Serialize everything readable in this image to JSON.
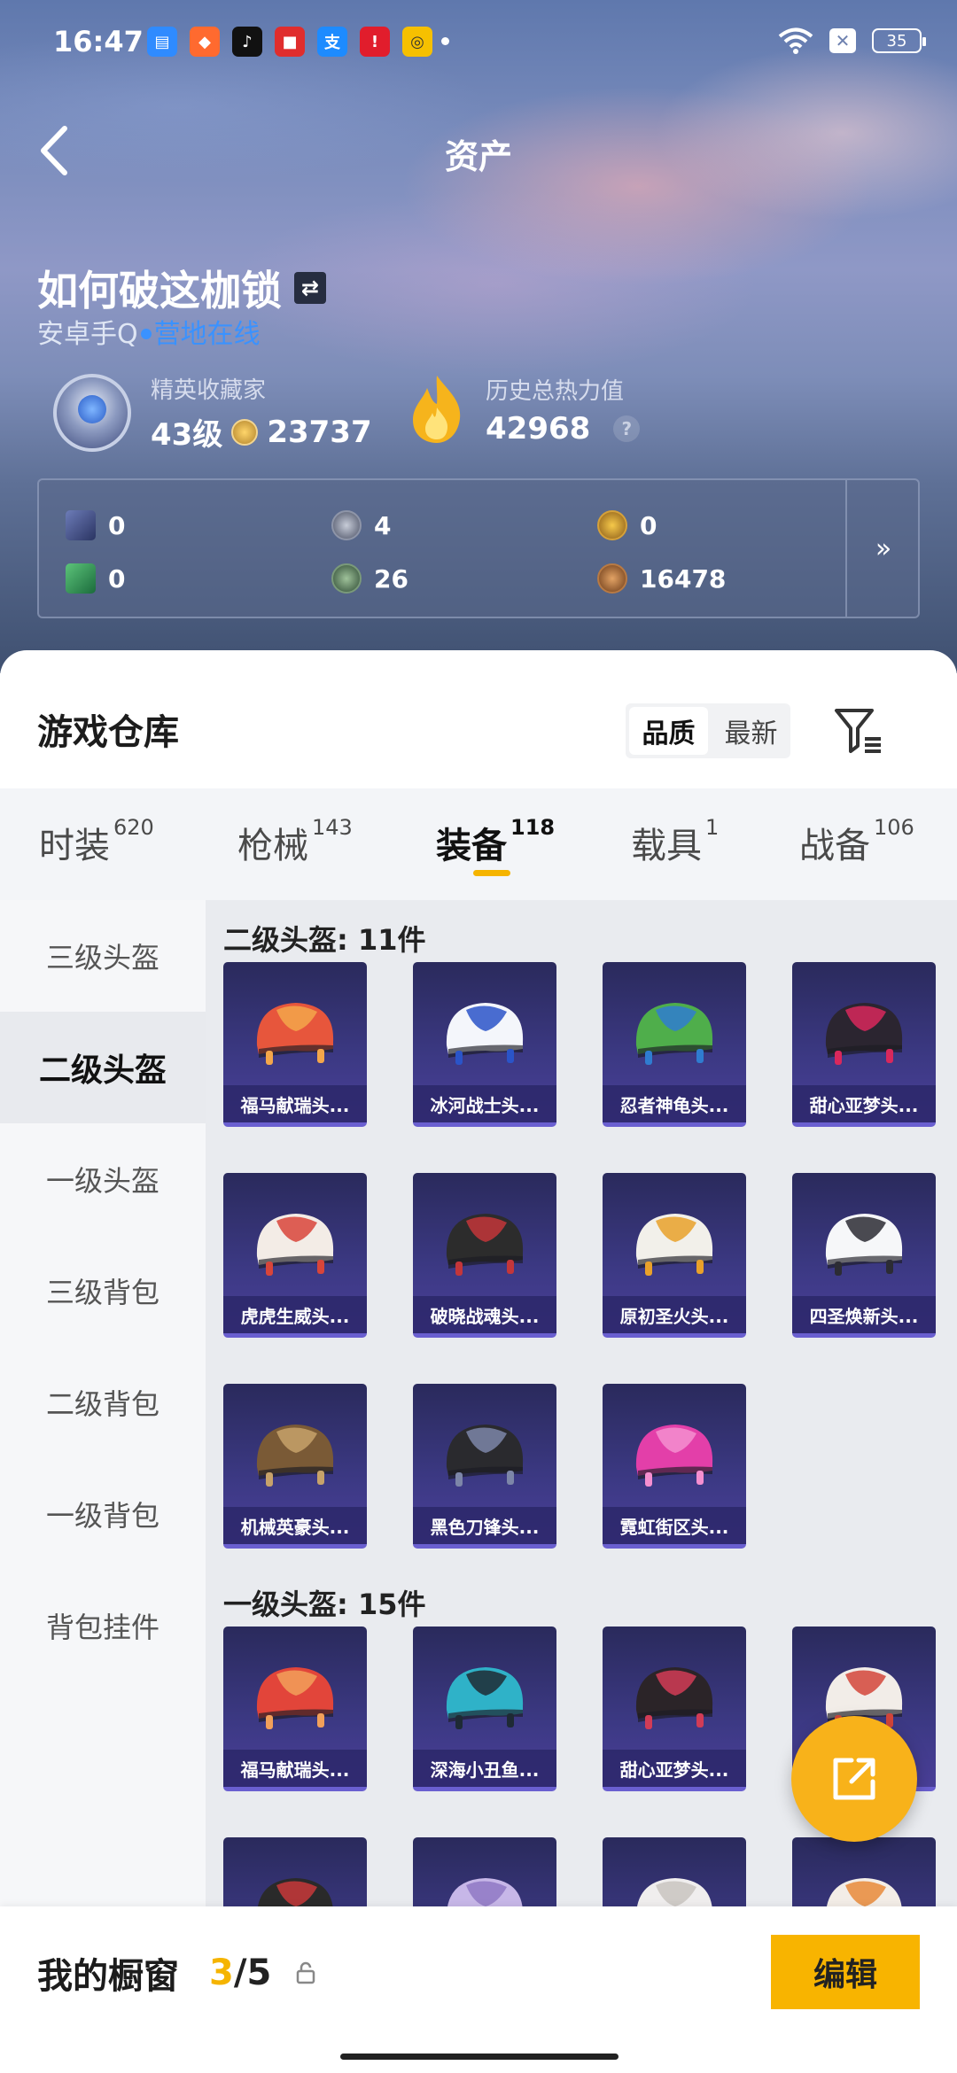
{
  "status_bar": {
    "time": "16:47",
    "battery": "35"
  },
  "header": {
    "title": "资产"
  },
  "profile": {
    "name": "如何破这枷锁",
    "platform": "安卓手Q",
    "online": "营地在线",
    "collector_label": "精英收藏家",
    "level": "43级",
    "collector_points": "23737",
    "heat_label": "历史总热力值",
    "heat_value": "42968",
    "help": "?"
  },
  "currencies": {
    "row1": [
      "0",
      "4",
      "0"
    ],
    "row2": [
      "0",
      "26",
      "16478"
    ],
    "more": "»"
  },
  "warehouse": {
    "title": "游戏仓库",
    "sort_options": [
      "品质",
      "最新"
    ],
    "active_sort": "品质",
    "tabs": [
      {
        "label": "时装",
        "count": "620"
      },
      {
        "label": "枪械",
        "count": "143"
      },
      {
        "label": "装备",
        "count": "118"
      },
      {
        "label": "载具",
        "count": "1"
      },
      {
        "label": "战备",
        "count": "106"
      }
    ],
    "active_tab": "装备",
    "sidebar": [
      "三级头盔",
      "二级头盔",
      "一级头盔",
      "三级背包",
      "二级背包",
      "一级背包",
      "背包挂件"
    ],
    "active_sidebar": "二级头盔",
    "sections": [
      {
        "title": "二级头盔: 11件",
        "items": [
          {
            "name": "福马献瑞头...",
            "colors": [
              "#e7563c",
              "#f3a64a"
            ]
          },
          {
            "name": "冰河战士头...",
            "colors": [
              "#f4f6fb",
              "#2a54c8"
            ]
          },
          {
            "name": "忍者神龟头...",
            "colors": [
              "#4fae4b",
              "#2f7cd0"
            ]
          },
          {
            "name": "甜心亚梦头...",
            "colors": [
              "#2b2530",
              "#d8285c"
            ]
          },
          {
            "name": "虎虎生威头...",
            "colors": [
              "#f3ece6",
              "#d8453a"
            ]
          },
          {
            "name": "破晓战魂头...",
            "colors": [
              "#2c2c2c",
              "#c3363a"
            ]
          },
          {
            "name": "原初圣火头...",
            "colors": [
              "#f2f0ea",
              "#e9a12a"
            ]
          },
          {
            "name": "四圣焕新头...",
            "colors": [
              "#f6f7f9",
              "#2c2c34"
            ]
          },
          {
            "name": "机械英豪头...",
            "colors": [
              "#7a5a36",
              "#c7a26a"
            ]
          },
          {
            "name": "黑色刀锋头...",
            "colors": [
              "#2a2a2e",
              "#7d86a8"
            ]
          },
          {
            "name": "霓虹街区头...",
            "colors": [
              "#e33fa9",
              "#f58fd0"
            ]
          }
        ]
      },
      {
        "title": "一级头盔: 15件",
        "items": [
          {
            "name": "福马献瑞头...",
            "colors": [
              "#e2453a",
              "#f2a05a"
            ]
          },
          {
            "name": "深海小丑鱼...",
            "colors": [
              "#2fb2c8",
              "#1e2a34"
            ]
          },
          {
            "name": "甜心亚梦头...",
            "colors": [
              "#2b2428",
              "#d23c56"
            ]
          },
          {
            "name": "",
            "colors": [
              "#f2ede8",
              "#d3453a"
            ]
          },
          {
            "name": "",
            "colors": [
              "#2a2a2a",
              "#c8383a"
            ]
          },
          {
            "name": "",
            "colors": [
              "#c7b7e8",
              "#8f79c4"
            ]
          },
          {
            "name": "",
            "colors": [
              "#f0eeee",
              "#c9c4c0"
            ]
          },
          {
            "name": "",
            "colors": [
              "#f3ede7",
              "#e78a3a"
            ]
          }
        ]
      }
    ]
  },
  "showcase": {
    "label": "我的橱窗",
    "current": "3",
    "separator": "/",
    "total": "5",
    "edit": "编辑"
  }
}
